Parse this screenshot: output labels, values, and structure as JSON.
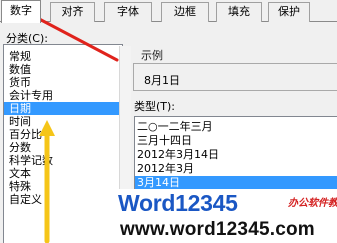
{
  "tabs": [
    {
      "label": "数字",
      "active": true
    },
    {
      "label": "对齐",
      "active": false
    },
    {
      "label": "字体",
      "active": false
    },
    {
      "label": "边框",
      "active": false
    },
    {
      "label": "填充",
      "active": false
    },
    {
      "label": "保护",
      "active": false
    }
  ],
  "category": {
    "label": "分类(C):",
    "items": [
      "常规",
      "数值",
      "货币",
      "会计专用",
      "日期",
      "时间",
      "百分比",
      "分数",
      "科学记数",
      "文本",
      "特殊",
      "自定义"
    ],
    "selected": "日期"
  },
  "sample": {
    "label": "示例",
    "value": "8月1日"
  },
  "type": {
    "label": "类型(T):",
    "items": [
      "二○一二年三月",
      "三月十四日",
      "2012年3月14日",
      "2012年3月",
      "3月14日"
    ],
    "selected": "3月14日"
  },
  "watermark": {
    "brand": "Word12345",
    "tagline": "办公软件教程",
    "url": "www.word12345.com"
  },
  "colors": {
    "selection": "#3399ff",
    "arrow": "#e0231c",
    "brand": "#1a57c4"
  }
}
